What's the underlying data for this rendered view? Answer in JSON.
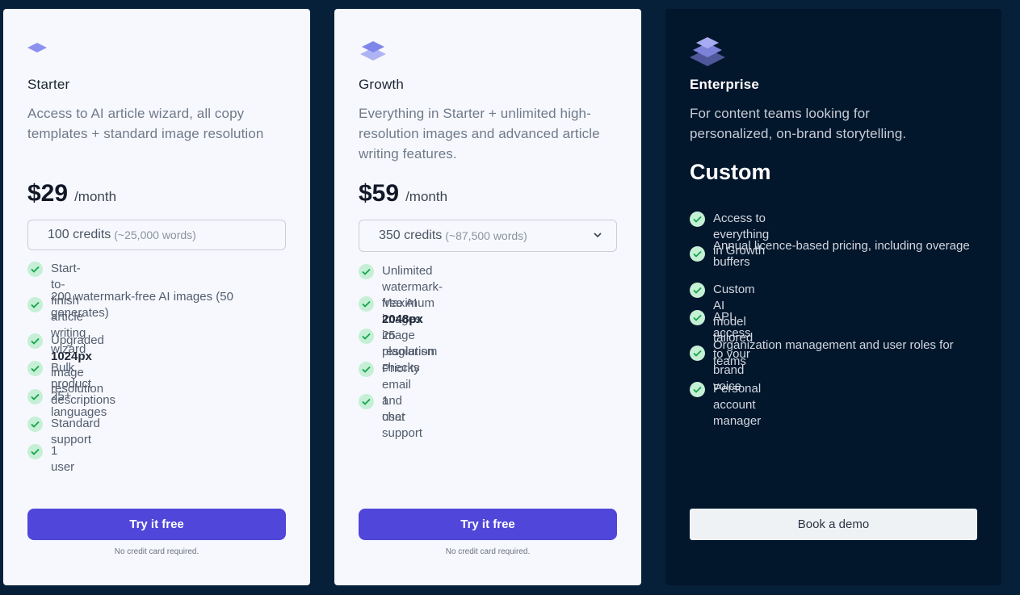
{
  "plans": [
    {
      "name": "Starter",
      "description": "Access to AI article wizard, all copy templates + standard image resolution",
      "price": "$29",
      "period": "/month",
      "credits": {
        "amount": "100 credits",
        "words": "(~25,000 words)"
      },
      "features": [
        {
          "text": "Start-to-finish article writing wizard"
        },
        {
          "text": "200 watermark-free AI images (50 generates)"
        },
        {
          "pre": "Upgraded ",
          "bold": "1024px",
          "post": " image resolution"
        },
        {
          "text": "Bulk product descriptions"
        },
        {
          "text": "25+ languages"
        },
        {
          "text": "Standard support"
        },
        {
          "text": "1 user"
        }
      ],
      "cta": "Try it free",
      "note": "No credit card required."
    },
    {
      "name": "Growth",
      "description": "Everything in Starter + unlimited high-resolution images and advanced article writing features.",
      "price": "$59",
      "period": "/month",
      "credits": {
        "amount": "350 credits",
        "words": "(~87,500 words)"
      },
      "features": [
        {
          "text": "Unlimited watermark-free AI images"
        },
        {
          "pre": "Maximum ",
          "bold": "2048px",
          "post": " image resolution"
        },
        {
          "text": "25 plagiarism checks"
        },
        {
          "text": "Priority email and chat support"
        },
        {
          "text": "1 user"
        }
      ],
      "cta": "Try it free",
      "note": "No credit card required."
    },
    {
      "name": "Enterprise",
      "description": "For content teams looking for personalized, on-brand storytelling.",
      "price": "Custom",
      "features": [
        {
          "text": "Access to everything in Growth"
        },
        {
          "text": "Annual licence-based pricing, including overage buffers"
        },
        {
          "text": "Custom AI model tailored to your brand voice"
        },
        {
          "text": "API access"
        },
        {
          "text": "Organization management and user roles for teams"
        },
        {
          "text": "Personal account manager"
        }
      ],
      "cta": "Book a demo"
    }
  ],
  "colors": {
    "page_bg": "#062039",
    "light_card": "#f7f8fd",
    "dark_card": "#02162c",
    "accent": "#5046d9",
    "check_bg": "#c5f0d6",
    "check_mark": "#16a34a"
  }
}
